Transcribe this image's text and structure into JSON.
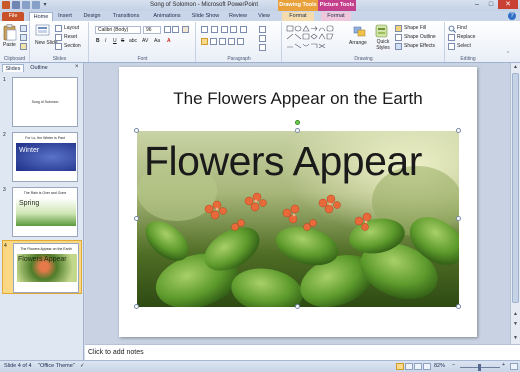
{
  "window": {
    "title": "Song of Solomon - Microsoft PowerPoint",
    "contextual_groups": [
      "Drawing Tools",
      "Picture Tools"
    ],
    "controls": [
      "–",
      "□",
      "✕"
    ]
  },
  "tabs": [
    "File",
    "Home",
    "Insert",
    "Design",
    "Transitions",
    "Animations",
    "Slide Show",
    "Review",
    "View",
    "Format",
    "Format"
  ],
  "ribbon": {
    "clipboard": {
      "paste": "Paste",
      "label": "Clipboard"
    },
    "slides": {
      "new_slide": "New Slide",
      "layout": "Layout",
      "reset": "Reset",
      "section": "Section",
      "label": "Slides"
    },
    "font": {
      "name": "Calibri (Body)",
      "size": "96",
      "label": "Font",
      "bold": "B",
      "italic": "I",
      "underline": "U",
      "strike": "S",
      "shadow": "abc",
      "spacing": "AV",
      "case": "Aa",
      "color": "A"
    },
    "paragraph": {
      "label": "Paragraph"
    },
    "drawing": {
      "arrange": "Arrange",
      "quick_styles": "Quick Styles",
      "shape_fill": "Shape Fill",
      "shape_outline": "Shape Outline",
      "shape_effects": "Shape Effects",
      "label": "Drawing"
    },
    "editing": {
      "find": "Find",
      "replace": "Replace",
      "select": "Select",
      "label": "Editing"
    }
  },
  "pane": {
    "tabs": [
      "Slides",
      "Outline"
    ],
    "close": "×",
    "slides": [
      {
        "number": "1",
        "title": "Song of Solomon",
        "banner": ""
      },
      {
        "number": "2",
        "title": "For Lo, the Winter is Past",
        "banner": "Winter"
      },
      {
        "number": "3",
        "title": "The Rain is Over and Gone",
        "banner": "Spring"
      },
      {
        "number": "4",
        "title": "The Flowers Appear on the Earth",
        "banner": "Flowers Appear"
      }
    ],
    "selected_index": 3
  },
  "slide": {
    "title": "The Flowers Appear on the Earth",
    "image_caption": "Flowers Appear"
  },
  "notes": {
    "placeholder": "Click to add notes"
  },
  "status": {
    "slide_info": "Slide 4 of 4",
    "theme": "\"Office Theme\"",
    "zoom": "82%"
  },
  "colors": {
    "file_tab": "#c8512a",
    "drawing_tools": "#e9a23b",
    "picture_tools": "#c4408c",
    "accent_blue": "#2f6dc6"
  }
}
